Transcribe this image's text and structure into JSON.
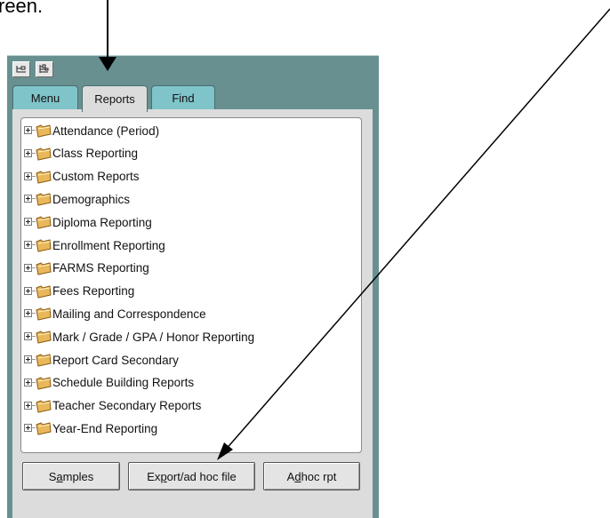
{
  "caption": "reen.",
  "toolbar": {
    "icon1": "collapse-tree-icon",
    "icon2": "expand-tree-icon"
  },
  "tabs": [
    {
      "label": "Menu",
      "active": false
    },
    {
      "label": "Reports",
      "active": true
    },
    {
      "label": "Find",
      "active": false
    }
  ],
  "tree": {
    "items": [
      {
        "label": "Attendance (Period)"
      },
      {
        "label": "Class Reporting"
      },
      {
        "label": "Custom Reports"
      },
      {
        "label": "Demographics"
      },
      {
        "label": "Diploma Reporting"
      },
      {
        "label": "Enrollment Reporting"
      },
      {
        "label": "FARMS Reporting"
      },
      {
        "label": "Fees Reporting"
      },
      {
        "label": "Mailing and Correspondence"
      },
      {
        "label": "Mark / Grade / GPA / Honor Reporting"
      },
      {
        "label": "Report Card Secondary"
      },
      {
        "label": "Schedule Building Reports"
      },
      {
        "label": "Teacher Secondary Reports"
      },
      {
        "label": "Year-End Reporting"
      }
    ]
  },
  "buttons": {
    "samples": {
      "pre": "S",
      "mnemonic": "a",
      "post": "mples"
    },
    "export": {
      "pre": "Ex",
      "mnemonic": "p",
      "post": "ort/ad hoc file"
    },
    "adhoc": {
      "pre": "A",
      "mnemonic": "d",
      "post": "hoc rpt"
    }
  },
  "colors": {
    "app_background": "#689091",
    "tab_inactive": "#7fc4c9",
    "panel": "#dcdcdc",
    "folder": "#e8b85a"
  }
}
